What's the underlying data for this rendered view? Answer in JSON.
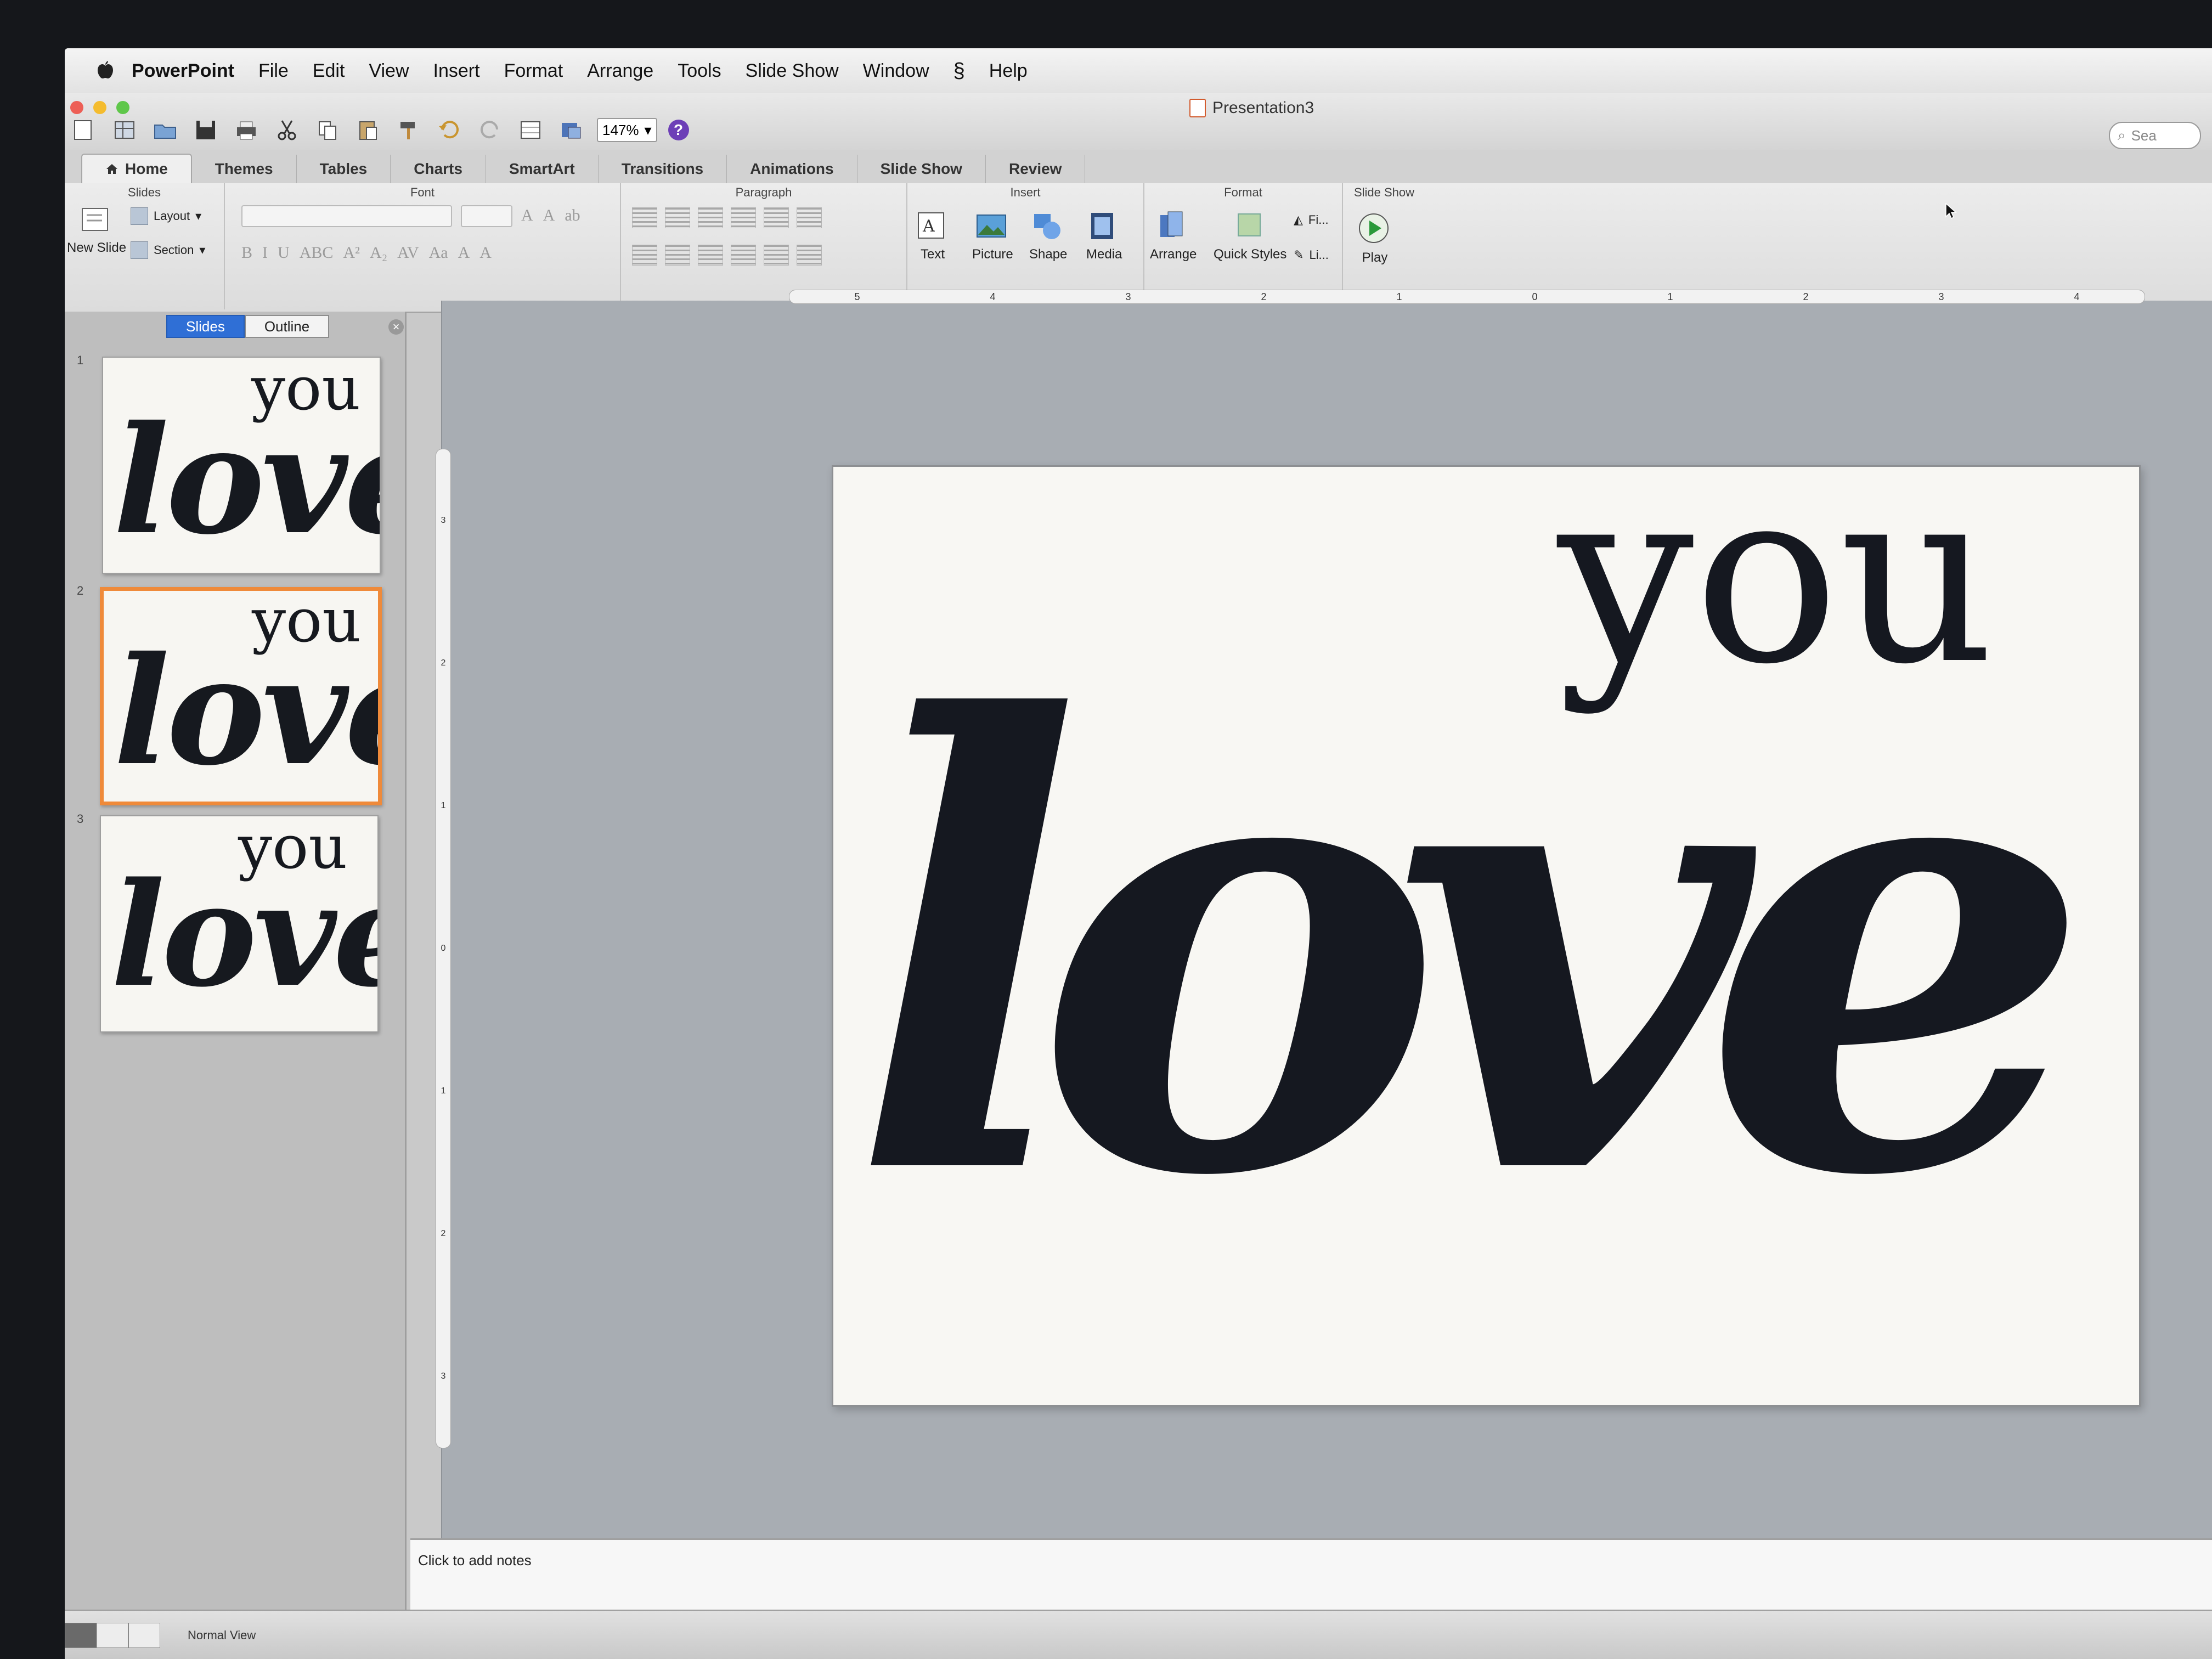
{
  "menubar": {
    "app_name": "PowerPoint",
    "items": [
      "File",
      "Edit",
      "View",
      "Insert",
      "Format",
      "Arrange",
      "Tools",
      "Slide Show",
      "Window",
      "Help"
    ]
  },
  "window": {
    "title": "Presentation3",
    "zoom": "147%",
    "help_symbol": "?",
    "search_placeholder": "Sea"
  },
  "ribbon_tabs": [
    "Home",
    "Themes",
    "Tables",
    "Charts",
    "SmartArt",
    "Transitions",
    "Animations",
    "Slide Show",
    "Review"
  ],
  "ribbon": {
    "groups": {
      "slides": "Slides",
      "font": "Font",
      "paragraph": "Paragraph",
      "insert": "Insert",
      "format": "Format",
      "slide_show": "Slide Show"
    },
    "buttons": {
      "new_slide": "New Slide",
      "layout": "Layout",
      "section": "Section",
      "text": "Text",
      "picture": "Picture",
      "shape": "Shape",
      "media": "Media",
      "arrange": "Arrange",
      "quick_styles": "Quick Styles",
      "play": "Play",
      "fill_short": "Fi...",
      "line_short": "Li..."
    },
    "font_controls": [
      "B",
      "I",
      "U",
      "ABC",
      "A²",
      "A₂",
      "AV",
      "Aa",
      "A",
      "A"
    ]
  },
  "left_panel": {
    "tab_slides": "Slides",
    "tab_outline": "Outline",
    "close_symbol": "×",
    "thumbnails": [
      {
        "number": "1",
        "top_word": "you",
        "main_word": "love"
      },
      {
        "number": "2",
        "top_word": "you",
        "main_word": "love"
      },
      {
        "number": "3",
        "top_word": "you",
        "main_word": "love"
      }
    ],
    "selected_index": 2
  },
  "ruler": {
    "h_labels": [
      "5",
      "4",
      "3",
      "2",
      "1",
      "0",
      "1",
      "2",
      "3",
      "4"
    ],
    "v_labels": [
      "3",
      "2",
      "1",
      "0",
      "1",
      "2",
      "3"
    ]
  },
  "slide": {
    "top_word": "you",
    "main_word": "love"
  },
  "notes": {
    "placeholder": "Click to add notes"
  },
  "status": {
    "view_label": "Normal View"
  },
  "colors": {
    "ink": "#151820",
    "selection": "#ef8a3a",
    "slides_tab_active": "#2f6fd6"
  }
}
